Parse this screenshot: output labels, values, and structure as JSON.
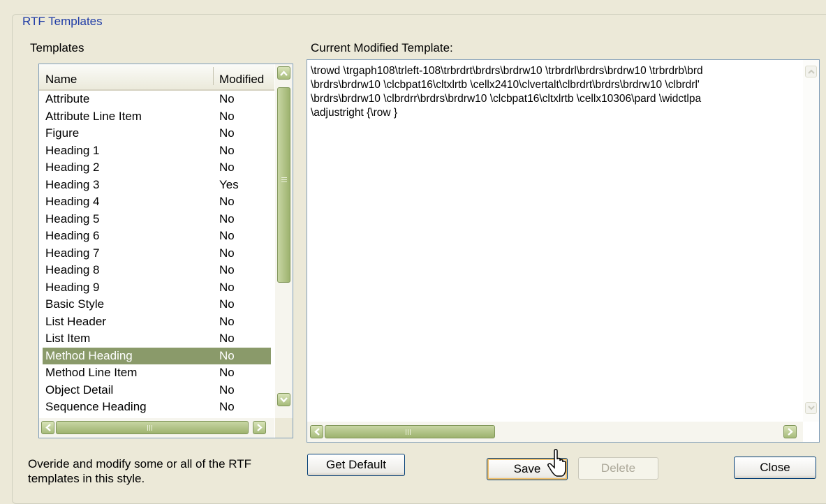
{
  "group": {
    "title": "RTF Templates"
  },
  "templates_label": "Templates",
  "current_label": "Current Modified Template:",
  "list": {
    "columns": [
      "Name",
      "Modified"
    ],
    "rows": [
      {
        "name": "Attribute",
        "modified": "No"
      },
      {
        "name": "Attribute Line Item",
        "modified": "No"
      },
      {
        "name": "Figure",
        "modified": "No"
      },
      {
        "name": "Heading 1",
        "modified": "No"
      },
      {
        "name": "Heading 2",
        "modified": "No"
      },
      {
        "name": "Heading 3",
        "modified": "Yes"
      },
      {
        "name": "Heading 4",
        "modified": "No"
      },
      {
        "name": "Heading 5",
        "modified": "No"
      },
      {
        "name": "Heading 6",
        "modified": "No"
      },
      {
        "name": "Heading 7",
        "modified": "No"
      },
      {
        "name": "Heading 8",
        "modified": "No"
      },
      {
        "name": "Heading 9",
        "modified": "No"
      },
      {
        "name": "Basic Style",
        "modified": "No"
      },
      {
        "name": "List Header",
        "modified": "No"
      },
      {
        "name": "List Item",
        "modified": "No"
      },
      {
        "name": "Method Heading",
        "modified": "No",
        "selected": true
      },
      {
        "name": "Method Line Item",
        "modified": "No"
      },
      {
        "name": "Object Detail",
        "modified": "No"
      },
      {
        "name": "Sequence Heading",
        "modified": "No"
      }
    ]
  },
  "template_text": "\\trowd \\trgaph108\\trleft-108\\trbrdrt\\brdrs\\brdrw10 \\trbrdrl\\brdrs\\brdrw10 \\trbrdrb\\brd\n\\brdrs\\brdrw10 \\clcbpat16\\cltxlrtb \\cellx2410\\clvertalt\\clbrdrt\\brdrs\\brdrw10 \\clbrdrl'\n\\brdrs\\brdrw10 \\clbrdrr\\brdrs\\brdrw10 \\clcbpat16\\cltxlrtb \\cellx10306\\pard \\widctlpa\n\\adjustright {\\row }",
  "help_text": "Overide and modify some or all of the RTF\ntemplates in this style.",
  "buttons": {
    "get_default": "Get Default",
    "save": "Save",
    "delete": "Delete",
    "close": "Close"
  },
  "colors": {
    "selection": "#8a9a6a",
    "scrollbar": "#a6bb7b",
    "group_title": "#1f3ca6"
  }
}
